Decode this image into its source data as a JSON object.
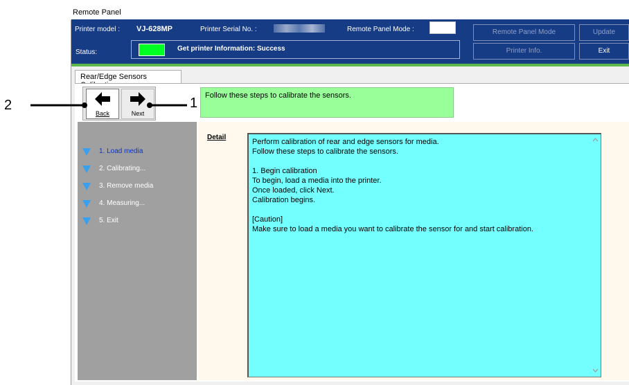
{
  "window": {
    "title": "Remote Panel"
  },
  "header": {
    "printer_model_label": "Printer model :",
    "printer_model_value": "VJ-628MP",
    "serial_label": "Printer Serial No. :",
    "remote_mode_label": "Remote Panel Mode :",
    "status_label": "Status:",
    "status_text": "Get printer Information: Success",
    "status_color": "#00ff22",
    "buttons": {
      "remote_panel_mode": "Remote Panel Mode",
      "update": "Update",
      "printer_info": "Printer Info.",
      "exit": "Exit"
    }
  },
  "tab": {
    "label": "Rear/Edge Sensors Calibration"
  },
  "toolbar": {
    "back_label": "Back",
    "next_label": "Next"
  },
  "info": {
    "text": "Follow these steps to calibrate the sensors."
  },
  "steps": [
    {
      "label": "1. Load media",
      "active": true
    },
    {
      "label": "2. Calibrating..."
    },
    {
      "label": "3. Remove media"
    },
    {
      "label": "4. Measuring..."
    },
    {
      "label": "5. Exit"
    }
  ],
  "detail": {
    "label": "Detail",
    "text": "Perform calibration of rear and edge sensors for media.\nFollow these steps to calibrate the sensors.\n\n1. Begin calibration\nTo begin, load a media into the printer.\nOnce loaded, click Next.\nCalibration begins.\n\n[Caution]\nMake sure to load a media you want to calibrate the sensor for and start calibration."
  },
  "callouts": {
    "one": "1",
    "two": "2"
  }
}
